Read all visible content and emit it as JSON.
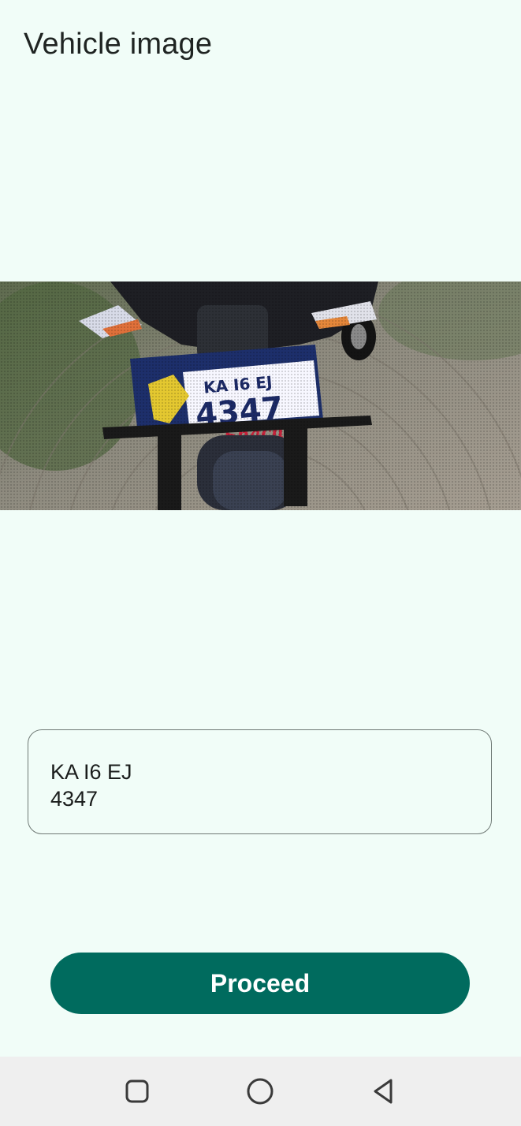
{
  "screen": {
    "title": "Vehicle image"
  },
  "photo": {
    "plate_line1": "KA I6 EJ",
    "plate_line2": "4347",
    "plate_script": "Shachi"
  },
  "plate_field": {
    "value": "KA I6 EJ\n4347"
  },
  "actions": {
    "proceed_label": "Proceed"
  },
  "nav": {
    "items": [
      "recents-icon",
      "home-icon",
      "back-icon"
    ]
  }
}
